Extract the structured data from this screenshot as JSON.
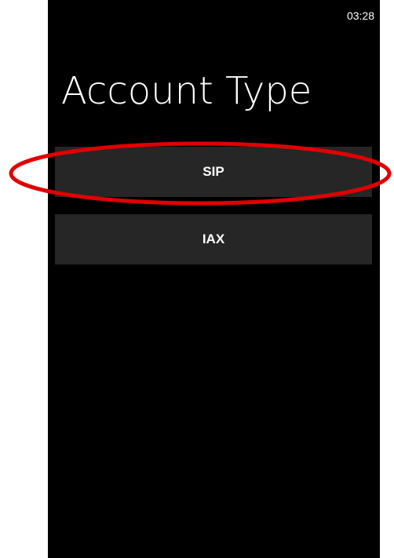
{
  "status_bar": {
    "time": "03:28"
  },
  "header": {
    "title": "Account Type"
  },
  "options": [
    {
      "label": "SIP"
    },
    {
      "label": "IAX"
    }
  ],
  "annotation": {
    "color": "#e00000",
    "shape": "ellipse"
  }
}
